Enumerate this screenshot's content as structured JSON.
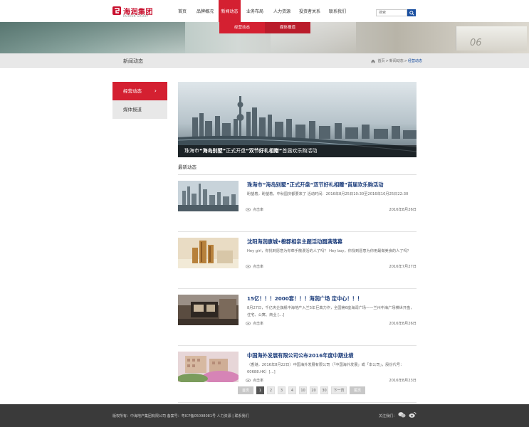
{
  "header": {
    "logo_cn": "海润集团",
    "logo_en": "HOIRUN GROUP",
    "nav": [
      {
        "label": "首页",
        "width": 26
      },
      {
        "label": "品牌概况",
        "width": 38
      },
      {
        "label": "新闻动态",
        "width": 31,
        "active": true
      },
      {
        "label": "业务布局",
        "width": 40
      },
      {
        "label": "人力资源",
        "width": 36
      },
      {
        "label": "投资者关系",
        "width": 42
      },
      {
        "label": "联系我们",
        "width": 36
      }
    ],
    "search_placeholder": "搜索"
  },
  "subnav": [
    "经营动态",
    "媒体报道"
  ],
  "titlebar": {
    "title": "新闻动态",
    "breadcrumb": {
      "home": "首页",
      "sep1": " > ",
      "section": "新闻动态",
      "sep2": " > ",
      "current": "经营动态"
    }
  },
  "sidebar": {
    "items": [
      {
        "label": "经营动态",
        "active": true,
        "arrow": "›"
      },
      {
        "label": "媒体报道",
        "active": false
      }
    ]
  },
  "hero": {
    "caption_pre": "珠海市",
    "caption_b1": "“海岛别墅”",
    "caption_mid": "正式开盘",
    "caption_b2": "“双节好礼相赠”",
    "caption_post": "首届欢乐购活动"
  },
  "latest_label": "最新动态",
  "news": [
    {
      "title": "珠海市“海岛别墅”正式开盘“双节好礼相赠”首届欢乐购活动",
      "desc": "盼望着，盼望着，中秋国庆都要来了 活动时间：2016年8月25日10:30至2016年10月25日22:30",
      "click": "点击率",
      "date": "2016年8月26日"
    },
    {
      "title": "沈阳海润康城•橙郡相亲主题活动圆满落幕",
      "desc": "Hey girl，你找到愿意为你牵手散漫活的人了吗？ Hey boy，你找到愿意为你用最做美食的人了吗？",
      "click": "点击率",
      "date": "2016年7月27日"
    },
    {
      "title": "15亿！！！2000套！！！海润广场 定中心！！！",
      "desc": "8月27日，千亿央企旗舰中海地产入兰5年巨典力作，全国第6座海润广场——兰州中海广场横世开盘，住宅、公寓、商业 [...]",
      "click": "点击率",
      "date": "2016年8月26日"
    },
    {
      "title": "中国海外发展有限公司公布2016年度中期业绩",
      "desc": "（香港，2016年8月22日）中国海外发展有限公司（「中国海外发展」或「本公司」，股份代号：00688.HK）[...]",
      "click": "点击率",
      "date": "2016年8月23日"
    }
  ],
  "pager": {
    "first": "首页",
    "pages": [
      "1",
      "2",
      "3",
      "4",
      "10",
      "20",
      "30"
    ],
    "current": "1",
    "next": "下一页",
    "last": "尾页"
  },
  "footer": {
    "copyright": "版权所有：中海地产集团有限公司 备案号：粤ICP备05098081号  人力资源 | 联系我们",
    "follow": "关注我们："
  },
  "colors": {
    "accent_red": "#d42031",
    "link_blue": "#1a3b7a",
    "footer_bg": "#3a3a3a"
  }
}
